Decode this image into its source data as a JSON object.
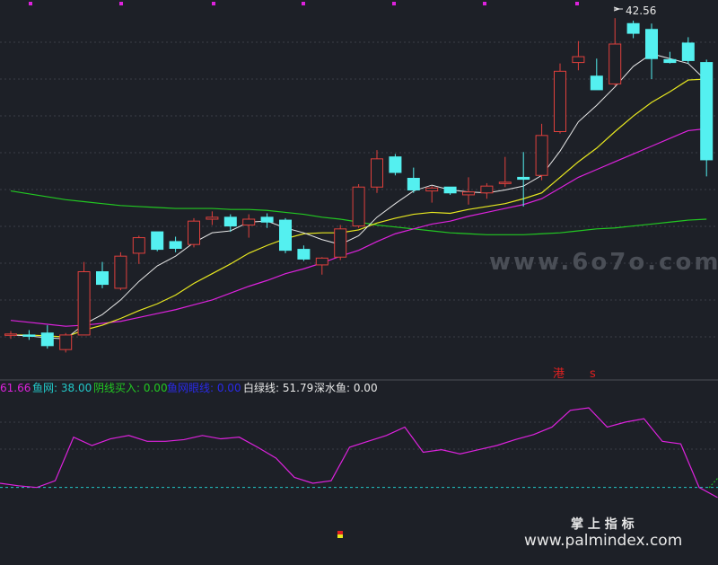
{
  "colors": {
    "background": "#1d2027",
    "grid": "#3a3e47",
    "up": "#e0403c",
    "down": "#54f0f0",
    "ma5": "#e8e8e8",
    "ma10": "#e8e820",
    "ma20": "#dd22dd",
    "ma60": "#22c822",
    "osc": "#dd22dd",
    "watermark": "#4a4e56"
  },
  "price_chart": {
    "type": "candlestick",
    "ylim": [
      7.5,
      43.5
    ],
    "high_marker": "42.56",
    "watermark": "www.6o7o.com",
    "annotations": [
      "港",
      "s"
    ],
    "candles": [
      {
        "o": 10.0,
        "h": 10.4,
        "l": 9.6,
        "c": 10.1
      },
      {
        "o": 10.0,
        "h": 10.5,
        "l": 9.5,
        "c": 9.9
      },
      {
        "o": 10.2,
        "h": 11.0,
        "l": 8.6,
        "c": 8.9
      },
      {
        "o": 8.5,
        "h": 10.2,
        "l": 8.2,
        "c": 10.0
      },
      {
        "o": 10.0,
        "h": 17.5,
        "l": 10.0,
        "c": 16.5
      },
      {
        "o": 16.5,
        "h": 17.5,
        "l": 14.8,
        "c": 15.2
      },
      {
        "o": 14.8,
        "h": 18.5,
        "l": 14.6,
        "c": 18.1
      },
      {
        "o": 18.4,
        "h": 20.2,
        "l": 17.3,
        "c": 20.0
      },
      {
        "o": 20.6,
        "h": 20.6,
        "l": 18.6,
        "c": 18.8
      },
      {
        "o": 19.6,
        "h": 20.1,
        "l": 18.5,
        "c": 18.9
      },
      {
        "o": 19.3,
        "h": 22.0,
        "l": 19.0,
        "c": 21.7
      },
      {
        "o": 21.9,
        "h": 22.7,
        "l": 21.3,
        "c": 22.1
      },
      {
        "o": 22.1,
        "h": 22.4,
        "l": 20.6,
        "c": 21.2
      },
      {
        "o": 21.3,
        "h": 22.4,
        "l": 20.0,
        "c": 21.9
      },
      {
        "o": 22.1,
        "h": 22.5,
        "l": 21.0,
        "c": 21.6
      },
      {
        "o": 21.8,
        "h": 22.0,
        "l": 18.4,
        "c": 18.7
      },
      {
        "o": 18.8,
        "h": 19.2,
        "l": 17.6,
        "c": 17.8
      },
      {
        "o": 17.2,
        "h": 18.0,
        "l": 16.2,
        "c": 17.9
      },
      {
        "o": 18.0,
        "h": 21.3,
        "l": 17.7,
        "c": 20.9
      },
      {
        "o": 21.2,
        "h": 25.5,
        "l": 21.0,
        "c": 25.2
      },
      {
        "o": 25.2,
        "h": 29.0,
        "l": 24.6,
        "c": 28.1
      },
      {
        "o": 28.3,
        "h": 28.6,
        "l": 26.4,
        "c": 26.7
      },
      {
        "o": 26.1,
        "h": 27.2,
        "l": 24.6,
        "c": 24.9
      },
      {
        "o": 24.8,
        "h": 25.3,
        "l": 23.6,
        "c": 25.1
      },
      {
        "o": 25.2,
        "h": 25.2,
        "l": 24.4,
        "c": 24.6
      },
      {
        "o": 24.4,
        "h": 26.2,
        "l": 23.4,
        "c": 24.7
      },
      {
        "o": 24.6,
        "h": 25.6,
        "l": 24.0,
        "c": 25.3
      },
      {
        "o": 25.6,
        "h": 28.3,
        "l": 25.2,
        "c": 25.7
      },
      {
        "o": 26.2,
        "h": 28.8,
        "l": 23.2,
        "c": 26.0
      },
      {
        "o": 26.4,
        "h": 31.7,
        "l": 25.9,
        "c": 30.5
      },
      {
        "o": 30.9,
        "h": 37.9,
        "l": 30.7,
        "c": 37.1
      },
      {
        "o": 38.0,
        "h": 40.2,
        "l": 37.2,
        "c": 38.6
      },
      {
        "o": 36.6,
        "h": 38.4,
        "l": 35.2,
        "c": 35.2
      },
      {
        "o": 35.8,
        "h": 42.56,
        "l": 35.6,
        "c": 39.9
      },
      {
        "o": 42.0,
        "h": 42.3,
        "l": 40.5,
        "c": 41.0
      },
      {
        "o": 41.4,
        "h": 42.0,
        "l": 36.3,
        "c": 38.4
      },
      {
        "o": 38.3,
        "h": 39.1,
        "l": 37.9,
        "c": 38.0
      },
      {
        "o": 40.0,
        "h": 40.6,
        "l": 37.9,
        "c": 38.2
      },
      {
        "o": 38.0,
        "h": 38.3,
        "l": 26.3,
        "c": 28.0
      }
    ],
    "ma5": [
      10.0,
      9.9,
      9.7,
      9.6,
      11.1,
      12.1,
      13.6,
      15.5,
      17.1,
      18.1,
      19.5,
      20.5,
      20.7,
      21.6,
      21.7,
      21.0,
      20.5,
      19.8,
      19.3,
      20.2,
      22.1,
      23.5,
      24.8,
      25.4,
      24.9,
      24.7,
      24.6,
      24.9,
      25.3,
      26.4,
      28.9,
      31.9,
      33.6,
      35.5,
      37.6,
      38.9,
      38.4,
      37.9,
      36.1
    ],
    "ma10": [
      10.0,
      10.0,
      9.9,
      9.8,
      10.5,
      11.0,
      11.7,
      12.5,
      13.2,
      14.1,
      15.3,
      16.3,
      17.3,
      18.4,
      19.2,
      19.9,
      20.4,
      20.5,
      20.5,
      20.8,
      21.5,
      22.0,
      22.4,
      22.6,
      22.5,
      22.9,
      23.2,
      23.5,
      24.0,
      24.6,
      26.2,
      27.8,
      29.2,
      30.9,
      32.5,
      33.9,
      35.0,
      36.2,
      36.3
    ],
    "ma20": [
      11.5,
      11.3,
      11.1,
      10.9,
      11.0,
      11.2,
      11.4,
      11.8,
      12.2,
      12.6,
      13.1,
      13.6,
      14.3,
      15.0,
      15.6,
      16.3,
      16.8,
      17.4,
      18.1,
      18.7,
      19.6,
      20.4,
      20.9,
      21.4,
      21.7,
      22.2,
      22.6,
      23.0,
      23.4,
      24.0,
      25.1,
      26.2,
      27.0,
      27.8,
      28.6,
      29.4,
      30.2,
      31.0,
      31.2
    ],
    "ma60": [
      24.8,
      24.5,
      24.2,
      23.9,
      23.7,
      23.5,
      23.3,
      23.2,
      23.1,
      23.0,
      23.0,
      23.0,
      22.9,
      22.9,
      22.8,
      22.6,
      22.4,
      22.1,
      21.9,
      21.6,
      21.3,
      21.1,
      20.9,
      20.7,
      20.5,
      20.4,
      20.3,
      20.3,
      20.3,
      20.4,
      20.5,
      20.7,
      20.9,
      21.0,
      21.2,
      21.4,
      21.6,
      21.8,
      21.9
    ]
  },
  "indicator": {
    "legend": [
      {
        "text": "61.66",
        "color": "#dd22dd"
      },
      {
        "text": "鱼网: 38.00",
        "color": "#22c8c8"
      },
      {
        "text": "阴线买入: 0.00",
        "color": "#22c822"
      },
      {
        "text": "鱼网眼线: 0.00",
        "color": "#2a2ae8"
      },
      {
        "text": "白绿线: 51.79",
        "color": "#e8e8e8"
      },
      {
        "text": "深水鱼: 0.00",
        "color": "#e8e8e8"
      }
    ],
    "ylim": [
      -40,
      110
    ],
    "baseline": 0,
    "values": [
      5,
      2,
      0,
      8,
      60,
      50,
      58,
      62,
      55,
      55,
      57,
      62,
      58,
      60,
      48,
      35,
      12,
      5,
      8,
      48,
      55,
      62,
      72,
      42,
      45,
      40,
      45,
      50,
      57,
      63,
      72,
      92,
      95,
      72,
      78,
      82,
      55,
      52,
      0,
      -12
    ]
  },
  "branding": {
    "title": "掌 上 指 标",
    "url": "www.palmindex.com"
  }
}
